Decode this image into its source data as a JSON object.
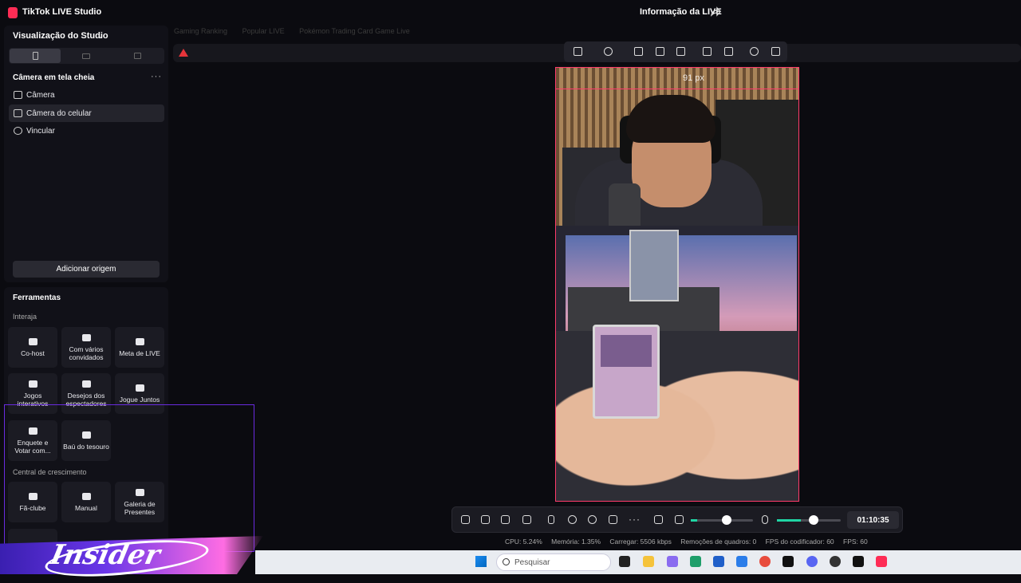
{
  "titlebar": {
    "app_title": "TikTok LIVE Studio",
    "live_info": "Informação da LIVE"
  },
  "sidebar": {
    "studio_title": "Visualização do Studio",
    "scene_name": "Câmera em tela cheia",
    "sources": [
      {
        "label": "Câmera",
        "icon": "camera-icon"
      },
      {
        "label": "Câmera do celular",
        "icon": "phone-camera-icon"
      },
      {
        "label": "Vincular",
        "icon": "globe-icon"
      }
    ],
    "add_source": "Adicionar origem"
  },
  "tools": {
    "title": "Ferramentas",
    "interact_label": "Interaja",
    "growth_label": "Central de crescimento",
    "interact": [
      "Co-host",
      "Com vários convidados",
      "Meta de LIVE",
      "Jogos interativos",
      "Desejos dos espectadores",
      "Jogue Juntos",
      "Enquete e Votar com...",
      "Baú do tesouro"
    ],
    "growth": [
      "Fã-clube",
      "Manual",
      "Galeria de Presentes"
    ]
  },
  "canvas": {
    "tabs": [
      "Gaming Ranking",
      "Popular LIVE",
      "Pokémon Trading Card Game Live"
    ],
    "selection_label": "91 px"
  },
  "controls": {
    "timer": "01:10:35",
    "volume_level": 0.5,
    "mic_level": 0.5
  },
  "stats": {
    "cpu": "CPU: 5.24%",
    "memory": "Memória: 1.35%",
    "upload": "Carregar: 5506 kbps",
    "dropped": "Remoções de quadros: 0",
    "encoder_fps": "FPS do codificador: 60",
    "fps": "FPS: 60"
  },
  "taskbar": {
    "search_placeholder": "Pesquisar"
  },
  "watermark": {
    "text": "Insider"
  },
  "colors": {
    "accent": "#fe2c55",
    "level": "#20d5a4",
    "selection": "#ff3b6b",
    "overlay": "#6a2be0"
  }
}
